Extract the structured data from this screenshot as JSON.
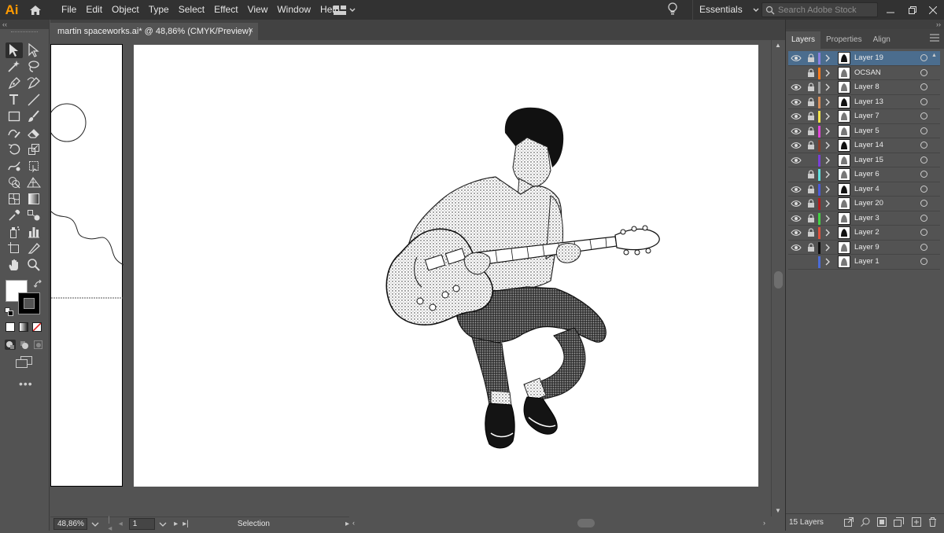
{
  "app": {
    "logo": "Ai"
  },
  "menu": [
    "File",
    "Edit",
    "Object",
    "Type",
    "Select",
    "Effect",
    "View",
    "Window",
    "Help"
  ],
  "workspace": {
    "label": "Essentials"
  },
  "search": {
    "placeholder": "Search Adobe Stock"
  },
  "document": {
    "tab_title": "martin spaceworks.ai* @ 48,86% (CMYK/Preview)",
    "close": "×"
  },
  "status": {
    "zoom": "48,86%",
    "page": "1",
    "tool": "Selection"
  },
  "panel": {
    "tabs": [
      "Layers",
      "Properties",
      "Align"
    ],
    "footer_count": "15 Layers",
    "layers": [
      {
        "name": "Layer 19",
        "color": "#8a7fe0",
        "visible": true,
        "locked": true,
        "selected": true
      },
      {
        "name": "OCSAN",
        "color": "#ff7b1c",
        "visible": false,
        "locked": true,
        "selected": false
      },
      {
        "name": "Layer 8",
        "color": "#9a9a9a",
        "visible": true,
        "locked": true,
        "selected": false
      },
      {
        "name": "Layer 13",
        "color": "#d88e5a",
        "visible": true,
        "locked": true,
        "selected": false
      },
      {
        "name": "Layer 7",
        "color": "#f2e14a",
        "visible": true,
        "locked": true,
        "selected": false
      },
      {
        "name": "Layer 5",
        "color": "#e045d8",
        "visible": true,
        "locked": true,
        "selected": false
      },
      {
        "name": "Layer 14",
        "color": "#8a3d2a",
        "visible": true,
        "locked": true,
        "selected": false
      },
      {
        "name": "Layer 15",
        "color": "#7a3fd8",
        "visible": true,
        "locked": false,
        "selected": false
      },
      {
        "name": "Layer 6",
        "color": "#5ee0e0",
        "visible": false,
        "locked": true,
        "selected": false
      },
      {
        "name": "Layer 4",
        "color": "#4b5ad8",
        "visible": true,
        "locked": true,
        "selected": false
      },
      {
        "name": "Layer 20",
        "color": "#b51e1e",
        "visible": true,
        "locked": true,
        "selected": false
      },
      {
        "name": "Layer 3",
        "color": "#44d044",
        "visible": true,
        "locked": true,
        "selected": false
      },
      {
        "name": "Layer 2",
        "color": "#e0503c",
        "visible": true,
        "locked": true,
        "selected": false
      },
      {
        "name": "Layer 9",
        "color": "#111111",
        "visible": true,
        "locked": true,
        "selected": false
      },
      {
        "name": "Layer 1",
        "color": "#4b6cd8",
        "visible": false,
        "locked": false,
        "selected": false
      }
    ]
  },
  "tools": [
    "selection-tool",
    "direct-selection-tool",
    "magic-wand-tool",
    "lasso-tool",
    "pen-tool",
    "curvature-tool",
    "type-tool",
    "line-tool",
    "rectangle-tool",
    "paintbrush-tool",
    "shaper-tool",
    "eraser-tool",
    "rotate-tool",
    "scale-tool",
    "warp-tool",
    "free-transform-tool",
    "shape-builder-tool",
    "perspective-grid-tool",
    "mesh-tool",
    "gradient-tool",
    "eyedropper-tool",
    "blend-tool",
    "symbol-sprayer-tool",
    "column-graph-tool",
    "artboard-tool",
    "slice-tool",
    "hand-tool",
    "zoom-tool"
  ]
}
